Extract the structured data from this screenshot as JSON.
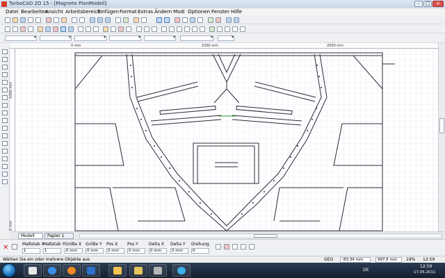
{
  "window": {
    "title": "TurboCAD 2D 15 - [Magnete PlanModell]"
  },
  "menu": [
    "Datei",
    "Bearbeiten",
    "Ansicht",
    "Arbeitsbereich",
    "Einfügen",
    "Format",
    "Extras",
    "Ändern",
    "Modi",
    "Optionen",
    "Fenster",
    "Hilfe"
  ],
  "rulers": {
    "h0": "0 mm",
    "h1": "1000 mm",
    "h2": "2000 mm",
    "v0": "0 mm",
    "v1": "1000 mm"
  },
  "tabs": {
    "model": "Modell",
    "paper": "Papier 1"
  },
  "inspector": {
    "labels": [
      "Maßstab X",
      "Maßstab Y",
      "Größe X",
      "Größe Y",
      "Pos X",
      "Pos Y",
      "Delta X",
      "Delta Y",
      "Drehung"
    ],
    "values": [
      "1",
      "1",
      "0 mm",
      "0 mm",
      "0 mm",
      "0 mm",
      "0 mm",
      "0 mm",
      "0"
    ]
  },
  "status": {
    "message": "Wählen Sie ein oder mehrere Objekte aus",
    "geo": "GEO",
    "x_coord": "-83,34 mm",
    "y_coord": "997,6 mm",
    "zoom": "19%",
    "time": "12:59"
  },
  "taskbar": {
    "lang": "DE",
    "time": "12:59",
    "date": "17.05.2011"
  },
  "icons": {
    "app": "turbocad-app-icon",
    "minimize": "minimize-icon",
    "maximize": "maximize-icon",
    "close": "close-icon",
    "start": "windows-start-icon",
    "delete": "delete-x-icon"
  },
  "colors": {
    "canvas": "#ffffff",
    "grid": "#d9d9ee",
    "drawing": "#2a2a3a",
    "accent_red": "#e03020",
    "accent_green": "#2ca02c"
  }
}
